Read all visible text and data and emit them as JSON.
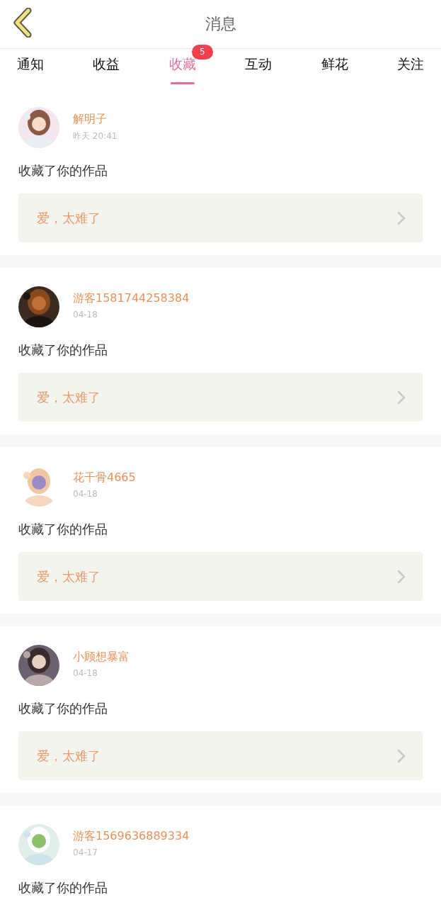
{
  "header": {
    "title": "消息"
  },
  "tabs": [
    {
      "label": "通知",
      "selected": false
    },
    {
      "label": "收益",
      "selected": false
    },
    {
      "label": "收藏",
      "selected": true,
      "badge": "5"
    },
    {
      "label": "互动",
      "selected": false
    },
    {
      "label": "鲜花",
      "selected": false
    },
    {
      "label": "关注",
      "selected": false
    }
  ],
  "messages": [
    {
      "name": "解明子",
      "time": "昨天 20:41",
      "action": "收藏了你的作品",
      "work": "爱，太难了"
    },
    {
      "name": "游客1581744258384",
      "time": "04-18",
      "action": "收藏了你的作品",
      "work": "爱，太难了"
    },
    {
      "name": "花千骨4665",
      "time": "04-18",
      "action": "收藏了你的作品",
      "work": "爱，太难了"
    },
    {
      "name": "小顾想暴富",
      "time": "04-18",
      "action": "收藏了你的作品",
      "work": "爱，太难了"
    },
    {
      "name": "游客1569636889334",
      "time": "04-17",
      "action": "收藏了你的作品"
    }
  ]
}
